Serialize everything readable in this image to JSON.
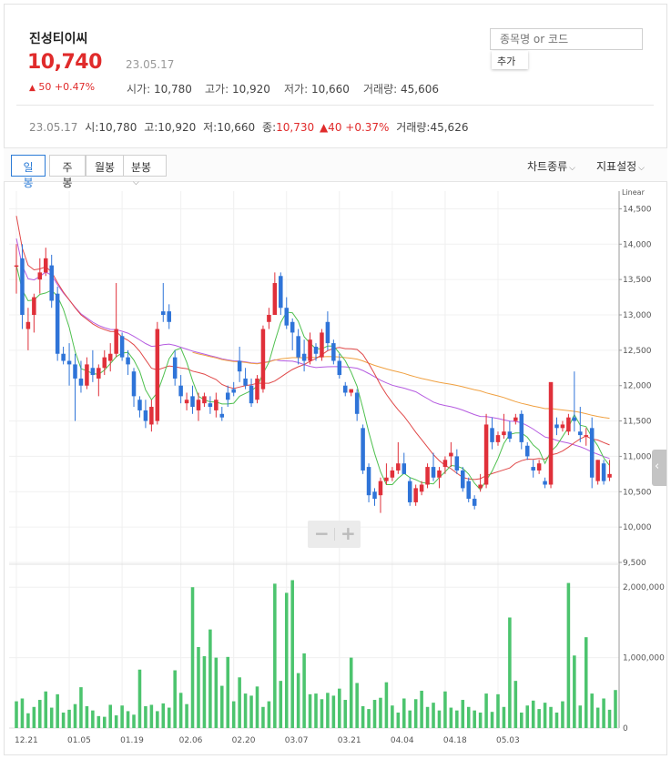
{
  "stock": {
    "name": "진성티이씨",
    "price": "10,740",
    "date": "23.05.17",
    "change_arrow": "▲",
    "change": "50",
    "change_pct": "+0.47%",
    "open_label": "시가",
    "open": "10,780",
    "high_label": "고가",
    "high": "10,920",
    "low_label": "저가",
    "low": "10,660",
    "volume_label": "거래량",
    "volume": "45,606"
  },
  "search": {
    "placeholder": "종목명 or 코드",
    "add_label": "추가"
  },
  "infoline": {
    "date": "23.05.17",
    "o_label": "시",
    "o": "10,780",
    "h_label": "고",
    "h": "10,920",
    "l_label": "저",
    "l": "10,660",
    "c_label": "종",
    "c": "10,730",
    "chg": "▲40",
    "chg_pct": "+0.37%",
    "vol_label": "거래량",
    "vol": "45,626"
  },
  "toolbar": {
    "tabs": [
      "일봉",
      "주봉",
      "월봉",
      "분봉"
    ],
    "chart_type_label": "차트종류",
    "indicator_label": "지표설정"
  },
  "colors": {
    "up": "#e0303a",
    "down": "#2f74d8",
    "ma5": "#4fc04f",
    "ma20": "#e04848",
    "ma60": "#b55be0",
    "ma120": "#f0a040",
    "volume": "#4cc46e"
  },
  "chart_data": [
    {
      "type": "candlestick",
      "scale_label": "Linear",
      "y_ticks": [
        "14,500",
        "14,000",
        "13,500",
        "13,000",
        "12,500",
        "12,000",
        "11,500",
        "11,000",
        "10,500",
        "10,000",
        "9,500"
      ],
      "ylim": [
        9500,
        14750
      ],
      "x_ticks": [
        "12.21",
        "01.05",
        "01.19",
        "02.06",
        "02.20",
        "03.07",
        "03.21",
        "04.04",
        "04.18",
        "05.03"
      ],
      "candles": [
        {
          "o": 13700,
          "h": 14000,
          "l": 13300,
          "c": 13700
        },
        {
          "o": 13800,
          "h": 14000,
          "l": 12800,
          "c": 13000
        },
        {
          "o": 12800,
          "h": 13100,
          "l": 12500,
          "c": 12900
        },
        {
          "o": 13000,
          "h": 13300,
          "l": 12750,
          "c": 13250
        },
        {
          "o": 13500,
          "h": 13800,
          "l": 13300,
          "c": 13600
        },
        {
          "o": 13600,
          "h": 13950,
          "l": 13550,
          "c": 13800
        },
        {
          "o": 13700,
          "h": 13850,
          "l": 13100,
          "c": 13200
        },
        {
          "o": 13300,
          "h": 13400,
          "l": 12350,
          "c": 12450
        },
        {
          "o": 12450,
          "h": 12550,
          "l": 12300,
          "c": 12350
        },
        {
          "o": 12350,
          "h": 12600,
          "l": 12000,
          "c": 12300
        },
        {
          "o": 12300,
          "h": 12450,
          "l": 11500,
          "c": 12100
        },
        {
          "o": 12100,
          "h": 12350,
          "l": 11900,
          "c": 12000
        },
        {
          "o": 12000,
          "h": 12400,
          "l": 11950,
          "c": 12300
        },
        {
          "o": 12250,
          "h": 12500,
          "l": 12050,
          "c": 12150
        },
        {
          "o": 12100,
          "h": 12300,
          "l": 11850,
          "c": 12250
        },
        {
          "o": 12250,
          "h": 12500,
          "l": 12150,
          "c": 12400
        },
        {
          "o": 12350,
          "h": 12600,
          "l": 12200,
          "c": 12450
        },
        {
          "o": 12450,
          "h": 13450,
          "l": 12400,
          "c": 12800
        },
        {
          "o": 12700,
          "h": 12750,
          "l": 12350,
          "c": 12400
        },
        {
          "o": 12400,
          "h": 12500,
          "l": 12150,
          "c": 12300
        },
        {
          "o": 12200,
          "h": 12250,
          "l": 11700,
          "c": 11850
        },
        {
          "o": 11800,
          "h": 11850,
          "l": 11550,
          "c": 11650
        },
        {
          "o": 11650,
          "h": 11800,
          "l": 11400,
          "c": 11500
        },
        {
          "o": 11450,
          "h": 11800,
          "l": 11350,
          "c": 11700
        },
        {
          "o": 11500,
          "h": 12900,
          "l": 11450,
          "c": 12800
        },
        {
          "o": 13050,
          "h": 13450,
          "l": 12900,
          "c": 13000
        },
        {
          "o": 13050,
          "h": 13150,
          "l": 12800,
          "c": 12900
        },
        {
          "o": 12400,
          "h": 12500,
          "l": 12000,
          "c": 12100
        },
        {
          "o": 12000,
          "h": 12150,
          "l": 11750,
          "c": 11850
        },
        {
          "o": 11750,
          "h": 11900,
          "l": 11650,
          "c": 11800
        },
        {
          "o": 11850,
          "h": 12000,
          "l": 11600,
          "c": 11700
        },
        {
          "o": 11650,
          "h": 11900,
          "l": 11500,
          "c": 11800
        },
        {
          "o": 11750,
          "h": 11900,
          "l": 11700,
          "c": 11850
        },
        {
          "o": 11750,
          "h": 11850,
          "l": 11600,
          "c": 11700
        },
        {
          "o": 11650,
          "h": 11900,
          "l": 11550,
          "c": 11800
        },
        {
          "o": 11600,
          "h": 11700,
          "l": 11500,
          "c": 11550
        },
        {
          "o": 11900,
          "h": 12000,
          "l": 11700,
          "c": 11800
        },
        {
          "o": 11950,
          "h": 12050,
          "l": 11850,
          "c": 11900
        },
        {
          "o": 12350,
          "h": 12550,
          "l": 12050,
          "c": 12200
        },
        {
          "o": 12100,
          "h": 12250,
          "l": 11950,
          "c": 12000
        },
        {
          "o": 12000,
          "h": 12100,
          "l": 11700,
          "c": 11750
        },
        {
          "o": 11800,
          "h": 12150,
          "l": 11750,
          "c": 12100
        },
        {
          "o": 11950,
          "h": 12850,
          "l": 11900,
          "c": 12800
        },
        {
          "o": 12900,
          "h": 13100,
          "l": 12800,
          "c": 13000
        },
        {
          "o": 13000,
          "h": 13600,
          "l": 13000,
          "c": 13450
        },
        {
          "o": 13550,
          "h": 13600,
          "l": 13000,
          "c": 13100
        },
        {
          "o": 13100,
          "h": 13250,
          "l": 12800,
          "c": 12850
        },
        {
          "o": 12900,
          "h": 12950,
          "l": 12500,
          "c": 12750
        },
        {
          "o": 12700,
          "h": 12800,
          "l": 12300,
          "c": 12400
        },
        {
          "o": 12450,
          "h": 12650,
          "l": 12200,
          "c": 12350
        },
        {
          "o": 12350,
          "h": 12750,
          "l": 12300,
          "c": 12650
        },
        {
          "o": 12550,
          "h": 12600,
          "l": 12350,
          "c": 12450
        },
        {
          "o": 12400,
          "h": 12800,
          "l": 12350,
          "c": 12750
        },
        {
          "o": 12900,
          "h": 13050,
          "l": 12500,
          "c": 12600
        },
        {
          "o": 12600,
          "h": 12650,
          "l": 12300,
          "c": 12350
        },
        {
          "o": 12350,
          "h": 12450,
          "l": 12100,
          "c": 12150
        },
        {
          "o": 12000,
          "h": 12050,
          "l": 11850,
          "c": 11900
        },
        {
          "o": 11900,
          "h": 11950,
          "l": 11850,
          "c": 11950
        },
        {
          "o": 11900,
          "h": 11950,
          "l": 11500,
          "c": 11600
        },
        {
          "o": 11400,
          "h": 11450,
          "l": 10750,
          "c": 10800
        },
        {
          "o": 10850,
          "h": 10900,
          "l": 10350,
          "c": 10450
        },
        {
          "o": 10500,
          "h": 10550,
          "l": 10300,
          "c": 10400
        },
        {
          "o": 10450,
          "h": 10700,
          "l": 10200,
          "c": 10650
        },
        {
          "o": 10650,
          "h": 10900,
          "l": 10600,
          "c": 10700
        },
        {
          "o": 10700,
          "h": 10850,
          "l": 10650,
          "c": 10800
        },
        {
          "o": 10800,
          "h": 11200,
          "l": 10750,
          "c": 10900
        },
        {
          "o": 10900,
          "h": 11050,
          "l": 10750,
          "c": 10750
        },
        {
          "o": 10650,
          "h": 10700,
          "l": 10300,
          "c": 10350
        },
        {
          "o": 10350,
          "h": 10600,
          "l": 10300,
          "c": 10550
        },
        {
          "o": 10500,
          "h": 10650,
          "l": 10450,
          "c": 10600
        },
        {
          "o": 10600,
          "h": 10900,
          "l": 10550,
          "c": 10850
        },
        {
          "o": 10850,
          "h": 11050,
          "l": 10650,
          "c": 10700
        },
        {
          "o": 10700,
          "h": 10850,
          "l": 10550,
          "c": 10800
        },
        {
          "o": 10850,
          "h": 11000,
          "l": 10750,
          "c": 10950
        },
        {
          "o": 11000,
          "h": 11200,
          "l": 10850,
          "c": 11050
        },
        {
          "o": 11000,
          "h": 11100,
          "l": 10750,
          "c": 10800
        },
        {
          "o": 10800,
          "h": 10850,
          "l": 10500,
          "c": 10550
        },
        {
          "o": 10650,
          "h": 10700,
          "l": 10350,
          "c": 10400
        },
        {
          "o": 10400,
          "h": 10450,
          "l": 10250,
          "c": 10300
        },
        {
          "o": 10550,
          "h": 10750,
          "l": 10500,
          "c": 10600
        },
        {
          "o": 10600,
          "h": 11600,
          "l": 10550,
          "c": 11450
        },
        {
          "o": 11400,
          "h": 11550,
          "l": 11100,
          "c": 11200
        },
        {
          "o": 11200,
          "h": 11350,
          "l": 11150,
          "c": 11300
        },
        {
          "o": 11300,
          "h": 11600,
          "l": 11250,
          "c": 11350
        },
        {
          "o": 11350,
          "h": 11500,
          "l": 11200,
          "c": 11250
        },
        {
          "o": 11500,
          "h": 11600,
          "l": 11450,
          "c": 11550
        },
        {
          "o": 11600,
          "h": 11650,
          "l": 11100,
          "c": 11200
        },
        {
          "o": 11150,
          "h": 11200,
          "l": 10950,
          "c": 11000
        },
        {
          "o": 10850,
          "h": 10950,
          "l": 10700,
          "c": 10800
        },
        {
          "o": 10800,
          "h": 10950,
          "l": 10750,
          "c": 10900
        },
        {
          "o": 10650,
          "h": 10700,
          "l": 10550,
          "c": 10600
        },
        {
          "o": 10600,
          "h": 11400,
          "l": 10550,
          "c": 12050
        },
        {
          "o": 11450,
          "h": 11550,
          "l": 11300,
          "c": 11400
        },
        {
          "o": 11400,
          "h": 11500,
          "l": 11350,
          "c": 11450
        },
        {
          "o": 11350,
          "h": 11600,
          "l": 11300,
          "c": 11550
        },
        {
          "o": 11550,
          "h": 12200,
          "l": 11350,
          "c": 11500
        },
        {
          "o": 11350,
          "h": 11700,
          "l": 11200,
          "c": 11300
        },
        {
          "o": 11300,
          "h": 11400,
          "l": 11150,
          "c": 11300
        },
        {
          "o": 11400,
          "h": 11550,
          "l": 10550,
          "c": 10700
        },
        {
          "o": 10650,
          "h": 10950,
          "l": 10600,
          "c": 10950
        },
        {
          "o": 10900,
          "h": 10950,
          "l": 10600,
          "c": 10650
        },
        {
          "o": 10700,
          "h": 10950,
          "l": 10650,
          "c": 10750
        }
      ]
    },
    {
      "type": "bar",
      "series_label": "volume",
      "y_ticks": [
        "2,000,000",
        "1,000,000",
        "0"
      ],
      "ylim": [
        0,
        2300000
      ],
      "values": [
        380000,
        420000,
        210000,
        300000,
        400000,
        520000,
        290000,
        480000,
        220000,
        260000,
        340000,
        580000,
        310000,
        250000,
        170000,
        160000,
        330000,
        180000,
        320000,
        240000,
        190000,
        830000,
        310000,
        330000,
        240000,
        350000,
        290000,
        820000,
        500000,
        340000,
        2000000,
        1150000,
        1020000,
        1400000,
        1000000,
        600000,
        1010000,
        380000,
        720000,
        490000,
        460000,
        590000,
        300000,
        380000,
        2050000,
        670000,
        1920000,
        2100000,
        780000,
        1060000,
        480000,
        490000,
        410000,
        500000,
        460000,
        560000,
        400000,
        1000000,
        640000,
        310000,
        270000,
        400000,
        430000,
        650000,
        320000,
        220000,
        420000,
        250000,
        410000,
        530000,
        300000,
        360000,
        250000,
        520000,
        290000,
        250000,
        400000,
        300000,
        250000,
        220000,
        490000,
        230000,
        480000,
        300000,
        1570000,
        670000,
        220000,
        320000,
        390000,
        270000,
        360000,
        300000,
        220000,
        380000,
        2060000,
        1030000,
        320000,
        1290000,
        490000,
        290000,
        420000,
        260000,
        540000
      ],
      "ma": [
        0
      ]
    }
  ]
}
